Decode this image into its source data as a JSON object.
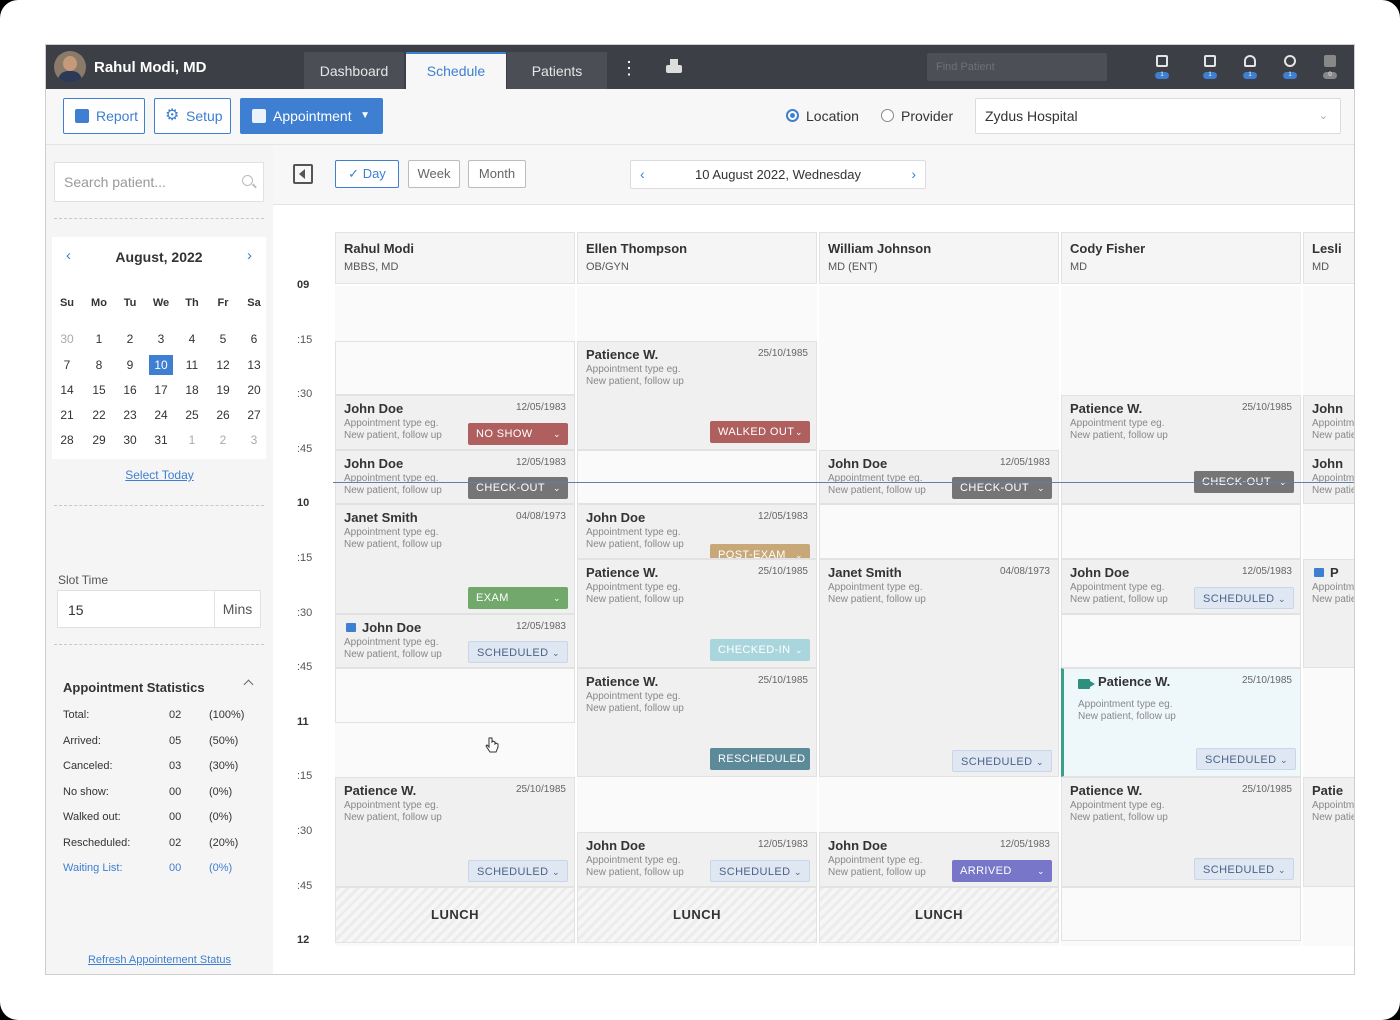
{
  "header": {
    "user_name": "Rahul Modi, MD",
    "tabs": [
      {
        "label": "Dashboard"
      },
      {
        "label": "Schedule"
      },
      {
        "label": "Patients"
      }
    ],
    "find_placeholder": "Find Patient",
    "icons": [
      {
        "name": "laptop-icon",
        "count": "1"
      },
      {
        "name": "calendar-icon",
        "count": "1"
      },
      {
        "name": "lab-flask-icon",
        "count": "1"
      },
      {
        "name": "pills-icon",
        "count": "1"
      },
      {
        "name": "document-icon",
        "count": "0"
      }
    ]
  },
  "toolbar": {
    "report_label": "Report",
    "setup_label": "Setup",
    "appointment_label": "Appointment",
    "location_label": "Location",
    "provider_label": "Provider",
    "location_value": "Zydus Hospital"
  },
  "sidebar": {
    "search_placeholder": "Search patient...",
    "calendar": {
      "month_label": "August, 2022",
      "weekdays": [
        "Su",
        "Mo",
        "Tu",
        "We",
        "Th",
        "Fr",
        "Sa"
      ],
      "weeks": [
        [
          "30",
          "1",
          "2",
          "3",
          "4",
          "5",
          "6"
        ],
        [
          "7",
          "8",
          "9",
          "10",
          "11",
          "12",
          "13"
        ],
        [
          "14",
          "15",
          "16",
          "17",
          "18",
          "19",
          "20"
        ],
        [
          "21",
          "22",
          "23",
          "24",
          "25",
          "26",
          "27"
        ],
        [
          "28",
          "29",
          "30",
          "31",
          "1",
          "2",
          "3"
        ]
      ],
      "selected": "10"
    },
    "select_today": "Select Today",
    "slot_time_label": "Slot Time",
    "slot_time_value": "15",
    "slot_time_unit": "Mins",
    "stats_title": "Appointment Statistics",
    "stats": [
      {
        "label": "Total:",
        "count": "02",
        "pct": "(100%)"
      },
      {
        "label": "Arrived:",
        "count": "05",
        "pct": "(50%)"
      },
      {
        "label": "Canceled:",
        "count": "03",
        "pct": "(30%)"
      },
      {
        "label": "No show:",
        "count": "00",
        "pct": "(0%)"
      },
      {
        "label": "Walked out:",
        "count": "00",
        "pct": "(0%)"
      },
      {
        "label": "Rescheduled:",
        "count": "02",
        "pct": "(20%)"
      },
      {
        "label": "Waiting List:",
        "count": "00",
        "pct": "(0%)"
      }
    ],
    "refresh_label": "Refresh Appointement Status"
  },
  "view": {
    "day": "Day",
    "week": "Week",
    "month": "Month",
    "date": "10 August 2022, Wednesday"
  },
  "times": [
    "09",
    ":15",
    ":30",
    ":45",
    "10",
    ":15",
    ":30",
    ":45",
    "11",
    ":15",
    ":30",
    ":45",
    "12"
  ],
  "providers": [
    {
      "name": "Rahul Modi",
      "spec": "MBBS, MD"
    },
    {
      "name": "Ellen Thompson",
      "spec": "OB/GYN"
    },
    {
      "name": "William Johnson",
      "spec": "MD (ENT)"
    },
    {
      "name": "Cody Fisher",
      "spec": "MD"
    },
    {
      "name": "Lesli",
      "spec": "MD"
    }
  ],
  "appt_line1": "Appointment type eg.",
  "appt_line2": "New patient, follow up",
  "appointments": [
    {
      "name": "John Doe",
      "dob": "12/05/1983",
      "status": "NO SHOW"
    },
    {
      "name": "John Doe",
      "dob": "12/05/1983",
      "status": "CHECK-OUT"
    },
    {
      "name": "Janet Smith",
      "dob": "04/08/1973",
      "status": "EXAM"
    },
    {
      "name": "John Doe",
      "dob": "12/05/1983",
      "status": "SCHEDULED"
    },
    {
      "name": "Patience W.",
      "dob": "25/10/1985",
      "status": "SCHEDULED"
    },
    {
      "name": "Patience W.",
      "dob": "25/10/1985",
      "status": "WALKED OUT"
    },
    {
      "name": "John Doe",
      "dob": "12/05/1983",
      "status": "POST-EXAM"
    },
    {
      "name": "Patience W.",
      "dob": "25/10/1985",
      "status": "CHECKED-IN"
    },
    {
      "name": "Patience W.",
      "dob": "25/10/1985",
      "status": "RESCHEDULED"
    },
    {
      "name": "John Doe",
      "dob": "12/05/1983",
      "status": "SCHEDULED"
    },
    {
      "name": "John Doe",
      "dob": "12/05/1983",
      "status": "CHECK-OUT"
    },
    {
      "name": "Janet Smith",
      "dob": "04/08/1973",
      "status": "SCHEDULED"
    },
    {
      "name": "John Doe",
      "dob": "12/05/1983",
      "status": "ARRIVED"
    },
    {
      "name": "Patience W.",
      "dob": "25/10/1985",
      "status": "CHECK-OUT"
    },
    {
      "name": "John Doe",
      "dob": "12/05/1983",
      "status": "SCHEDULED"
    },
    {
      "name": "Patience W.",
      "dob": "25/10/1985",
      "status": "SCHEDULED"
    },
    {
      "name": "Patience W.",
      "dob": "25/10/1985",
      "status": "SCHEDULED"
    },
    {
      "name": "John",
      "name_short": "John"
    },
    {
      "name": "John"
    },
    {
      "name": "P"
    },
    {
      "name": "Patie"
    }
  ],
  "lunch_label": "LUNCH",
  "colors": {
    "accent": "#3e7fd1",
    "topbar": "#3c3f45",
    "no_show": "#b05f5f",
    "check_out": "#757575",
    "exam": "#72a86b",
    "arrived": "#7876c8",
    "rescheduled": "#5c8a99"
  }
}
